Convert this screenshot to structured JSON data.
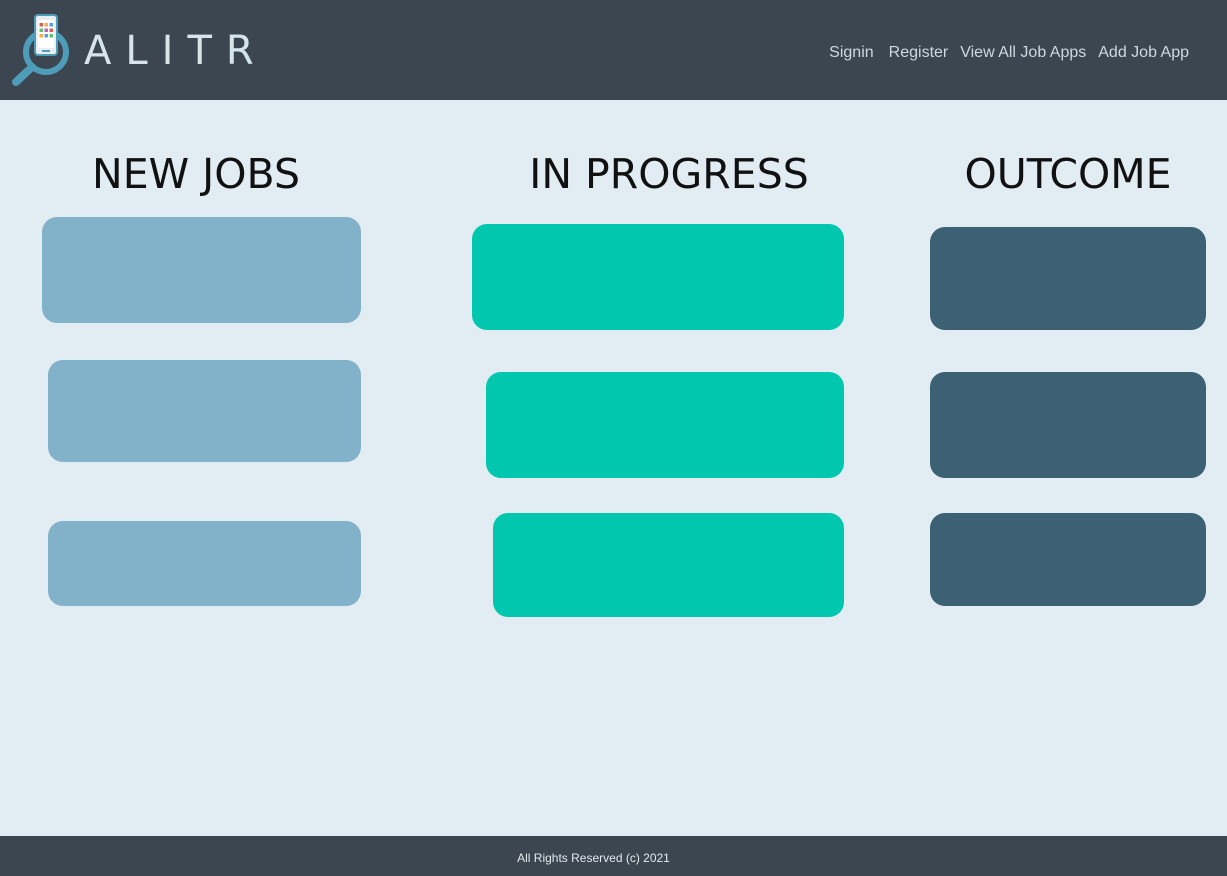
{
  "header": {
    "brand": "ALITR",
    "logo_icon": "phone-magnifier-icon",
    "nav": {
      "signin": "Signin",
      "register": "Register",
      "view_all": "View All Job Apps",
      "add_job": "Add Job App"
    }
  },
  "board": {
    "columns": [
      {
        "title": "NEW JOBS",
        "color": "#82b1ca",
        "cards": 3
      },
      {
        "title": "IN PROGRESS",
        "color": "#00c7ae",
        "cards": 3
      },
      {
        "title": "OUTCOME",
        "color": "#3c6175",
        "cards": 3
      }
    ]
  },
  "footer": {
    "text": "All Rights Reserved (c) 2021"
  },
  "colors": {
    "header_bg": "#3b4650",
    "page_bg": "#e1ecf3"
  }
}
